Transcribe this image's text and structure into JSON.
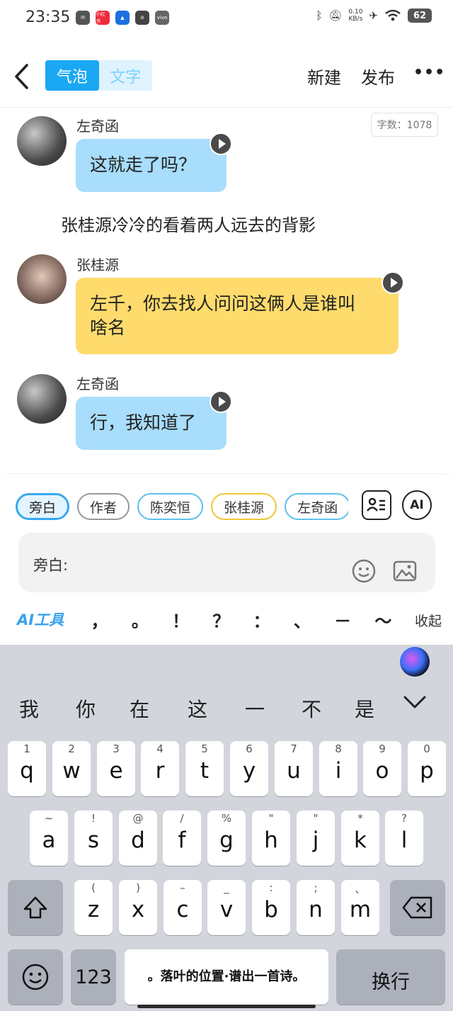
{
  "status_bar": {
    "time": "23:35",
    "apps": [
      "mail",
      "小红书",
      "feishu",
      "link",
      "vivo"
    ],
    "net_speed_value": "0.10",
    "net_speed_unit": "KB/s",
    "battery": "62"
  },
  "header": {
    "back_symbol": "<",
    "tabs": [
      "气泡",
      "文字"
    ],
    "active_tab": 0,
    "new_label": "新建",
    "publish_label": "发布",
    "more_label": "•••"
  },
  "chat": {
    "word_count": "字数：1078",
    "messages": [
      {
        "speaker": "左奇函",
        "text": "这就走了吗？"
      },
      {
        "narration": "张桂源冷冷的看着两人远去的背影"
      },
      {
        "speaker": "张桂源",
        "text_line1": "左千，你去找人问问这俩人是谁叫",
        "text_line2": "啥名"
      },
      {
        "speaker": "左奇函",
        "text": "行，我知道了"
      }
    ]
  },
  "composer": {
    "chips": [
      "旁白",
      "作者",
      "陈奕恒",
      "张桂源",
      "左奇函"
    ],
    "selected_chip": 0,
    "ai_label": "AI",
    "input_label": "旁白:",
    "ai_tools_label": "AI工具",
    "punctuation": [
      "，",
      "。",
      "！",
      "？",
      "：",
      "、",
      "－",
      "～"
    ],
    "collapse_label": "收起"
  },
  "keyboard": {
    "candidates": [
      "我",
      "你",
      "在",
      "这",
      "一",
      "不",
      "是"
    ],
    "row1": [
      {
        "main": "q",
        "sub": "1"
      },
      {
        "main": "w",
        "sub": "2"
      },
      {
        "main": "e",
        "sub": "3"
      },
      {
        "main": "r",
        "sub": "4"
      },
      {
        "main": "t",
        "sub": "5"
      },
      {
        "main": "y",
        "sub": "6"
      },
      {
        "main": "u",
        "sub": "7"
      },
      {
        "main": "i",
        "sub": "8"
      },
      {
        "main": "o",
        "sub": "9"
      },
      {
        "main": "p",
        "sub": "0"
      }
    ],
    "row2": [
      {
        "main": "a",
        "sub": "~"
      },
      {
        "main": "s",
        "sub": "!"
      },
      {
        "main": "d",
        "sub": "@"
      },
      {
        "main": "f",
        "sub": "/"
      },
      {
        "main": "g",
        "sub": "%"
      },
      {
        "main": "h",
        "sub": "\""
      },
      {
        "main": "j",
        "sub": "\""
      },
      {
        "main": "k",
        "sub": "*"
      },
      {
        "main": "l",
        "sub": "?"
      }
    ],
    "row3": [
      {
        "main": "z",
        "sub": "("
      },
      {
        "main": "x",
        "sub": ")"
      },
      {
        "main": "c",
        "sub": "–"
      },
      {
        "main": "v",
        "sub": "_"
      },
      {
        "main": "b",
        "sub": ":"
      },
      {
        "main": "n",
        "sub": ";"
      },
      {
        "main": "m",
        "sub": "、"
      }
    ],
    "num_label": "123",
    "space_label": "。落叶的位置·谱出一首诗。",
    "enter_label": "换行"
  }
}
